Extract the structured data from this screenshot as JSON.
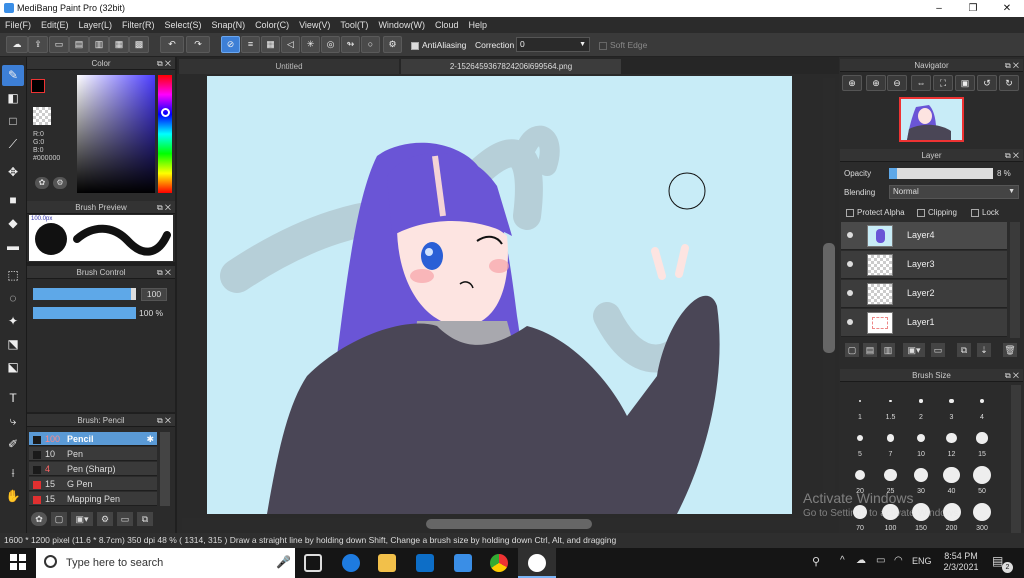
{
  "window": {
    "title": "MediBang Paint Pro (32bit)",
    "min": "–",
    "max": "❐",
    "close": "✕"
  },
  "menu": [
    "File(F)",
    "Edit(E)",
    "Layer(L)",
    "Filter(R)",
    "Select(S)",
    "Snap(N)",
    "Color(C)",
    "View(V)",
    "Tool(T)",
    "Window(W)",
    "Cloud",
    "Help"
  ],
  "toolbar": {
    "antialias": "AntiAliasing",
    "correction_label": "Correction",
    "correction_value": "0",
    "soft_edge": "Soft Edge"
  },
  "color_panel": {
    "title": "Color",
    "rgb": [
      "R:0",
      "G:0",
      "B:0"
    ],
    "hex": "#000000"
  },
  "brush_preview": {
    "title": "Brush Preview",
    "size_label": "100.0px"
  },
  "brush_control": {
    "title": "Brush Control",
    "size": "100",
    "opacity": "100 %",
    "size_fill": 0.95,
    "opacity_fill": 1.0
  },
  "brush_list": {
    "title": "Brush: Pencil",
    "items": [
      {
        "size": "100",
        "name": "Pencil",
        "color": "#1a1a1a",
        "selected": true
      },
      {
        "size": "10",
        "name": "Pen",
        "color": "#1a1a1a",
        "selected": false
      },
      {
        "size": "4",
        "name": "Pen (Sharp)",
        "color": "#1a1a1a",
        "selected": false
      },
      {
        "size": "15",
        "name": "G Pen",
        "color": "#e03030",
        "selected": false
      },
      {
        "size": "15",
        "name": "Mapping Pen",
        "color": "#e03030",
        "selected": false
      }
    ]
  },
  "tabs": [
    {
      "label": "Untitled"
    },
    {
      "label": "2-1526459367824206l699564.png"
    }
  ],
  "navigator": {
    "title": "Navigator"
  },
  "layer_panel": {
    "title": "Layer",
    "opacity_label": "Opacity",
    "opacity_value": "8 %",
    "opacity_fill": 0.08,
    "blending_label": "Blending",
    "blending_value": "Normal",
    "protect_alpha": "Protect Alpha",
    "clipping": "Clipping",
    "lock": "Lock",
    "layers": [
      {
        "name": "Layer4",
        "selected": true
      },
      {
        "name": "Layer3",
        "selected": false
      },
      {
        "name": "Layer2",
        "selected": false
      },
      {
        "name": "Layer1",
        "selected": false
      }
    ]
  },
  "brush_size": {
    "title": "Brush Size",
    "sizes": [
      "1",
      "1.5",
      "2",
      "3",
      "4",
      "5",
      "7",
      "10",
      "12",
      "15",
      "20",
      "25",
      "30",
      "40",
      "50",
      "70",
      "100",
      "150",
      "200",
      "300"
    ]
  },
  "status": {
    "text": "1600 * 1200 pixel   (11.6 * 8.7cm)   350 dpi   48 %   ( 1314, 315 )   Draw a straight line by holding down Shift, Change a brush size by holding down Ctrl, Alt, and dragging"
  },
  "activate": {
    "line1": "Activate Windows",
    "line2": "Go to Settings to activate Windows."
  },
  "taskbar": {
    "search_placeholder": "Type here to search",
    "time": "8:54 PM",
    "date": "2/3/2021",
    "lang": "ENG",
    "notif_count": "2"
  },
  "colors": {
    "canvas_bg": "#c8ecf7",
    "hair": "#6a55d6",
    "hoodie": "#4a4656",
    "accent": "#3d7fd6"
  }
}
